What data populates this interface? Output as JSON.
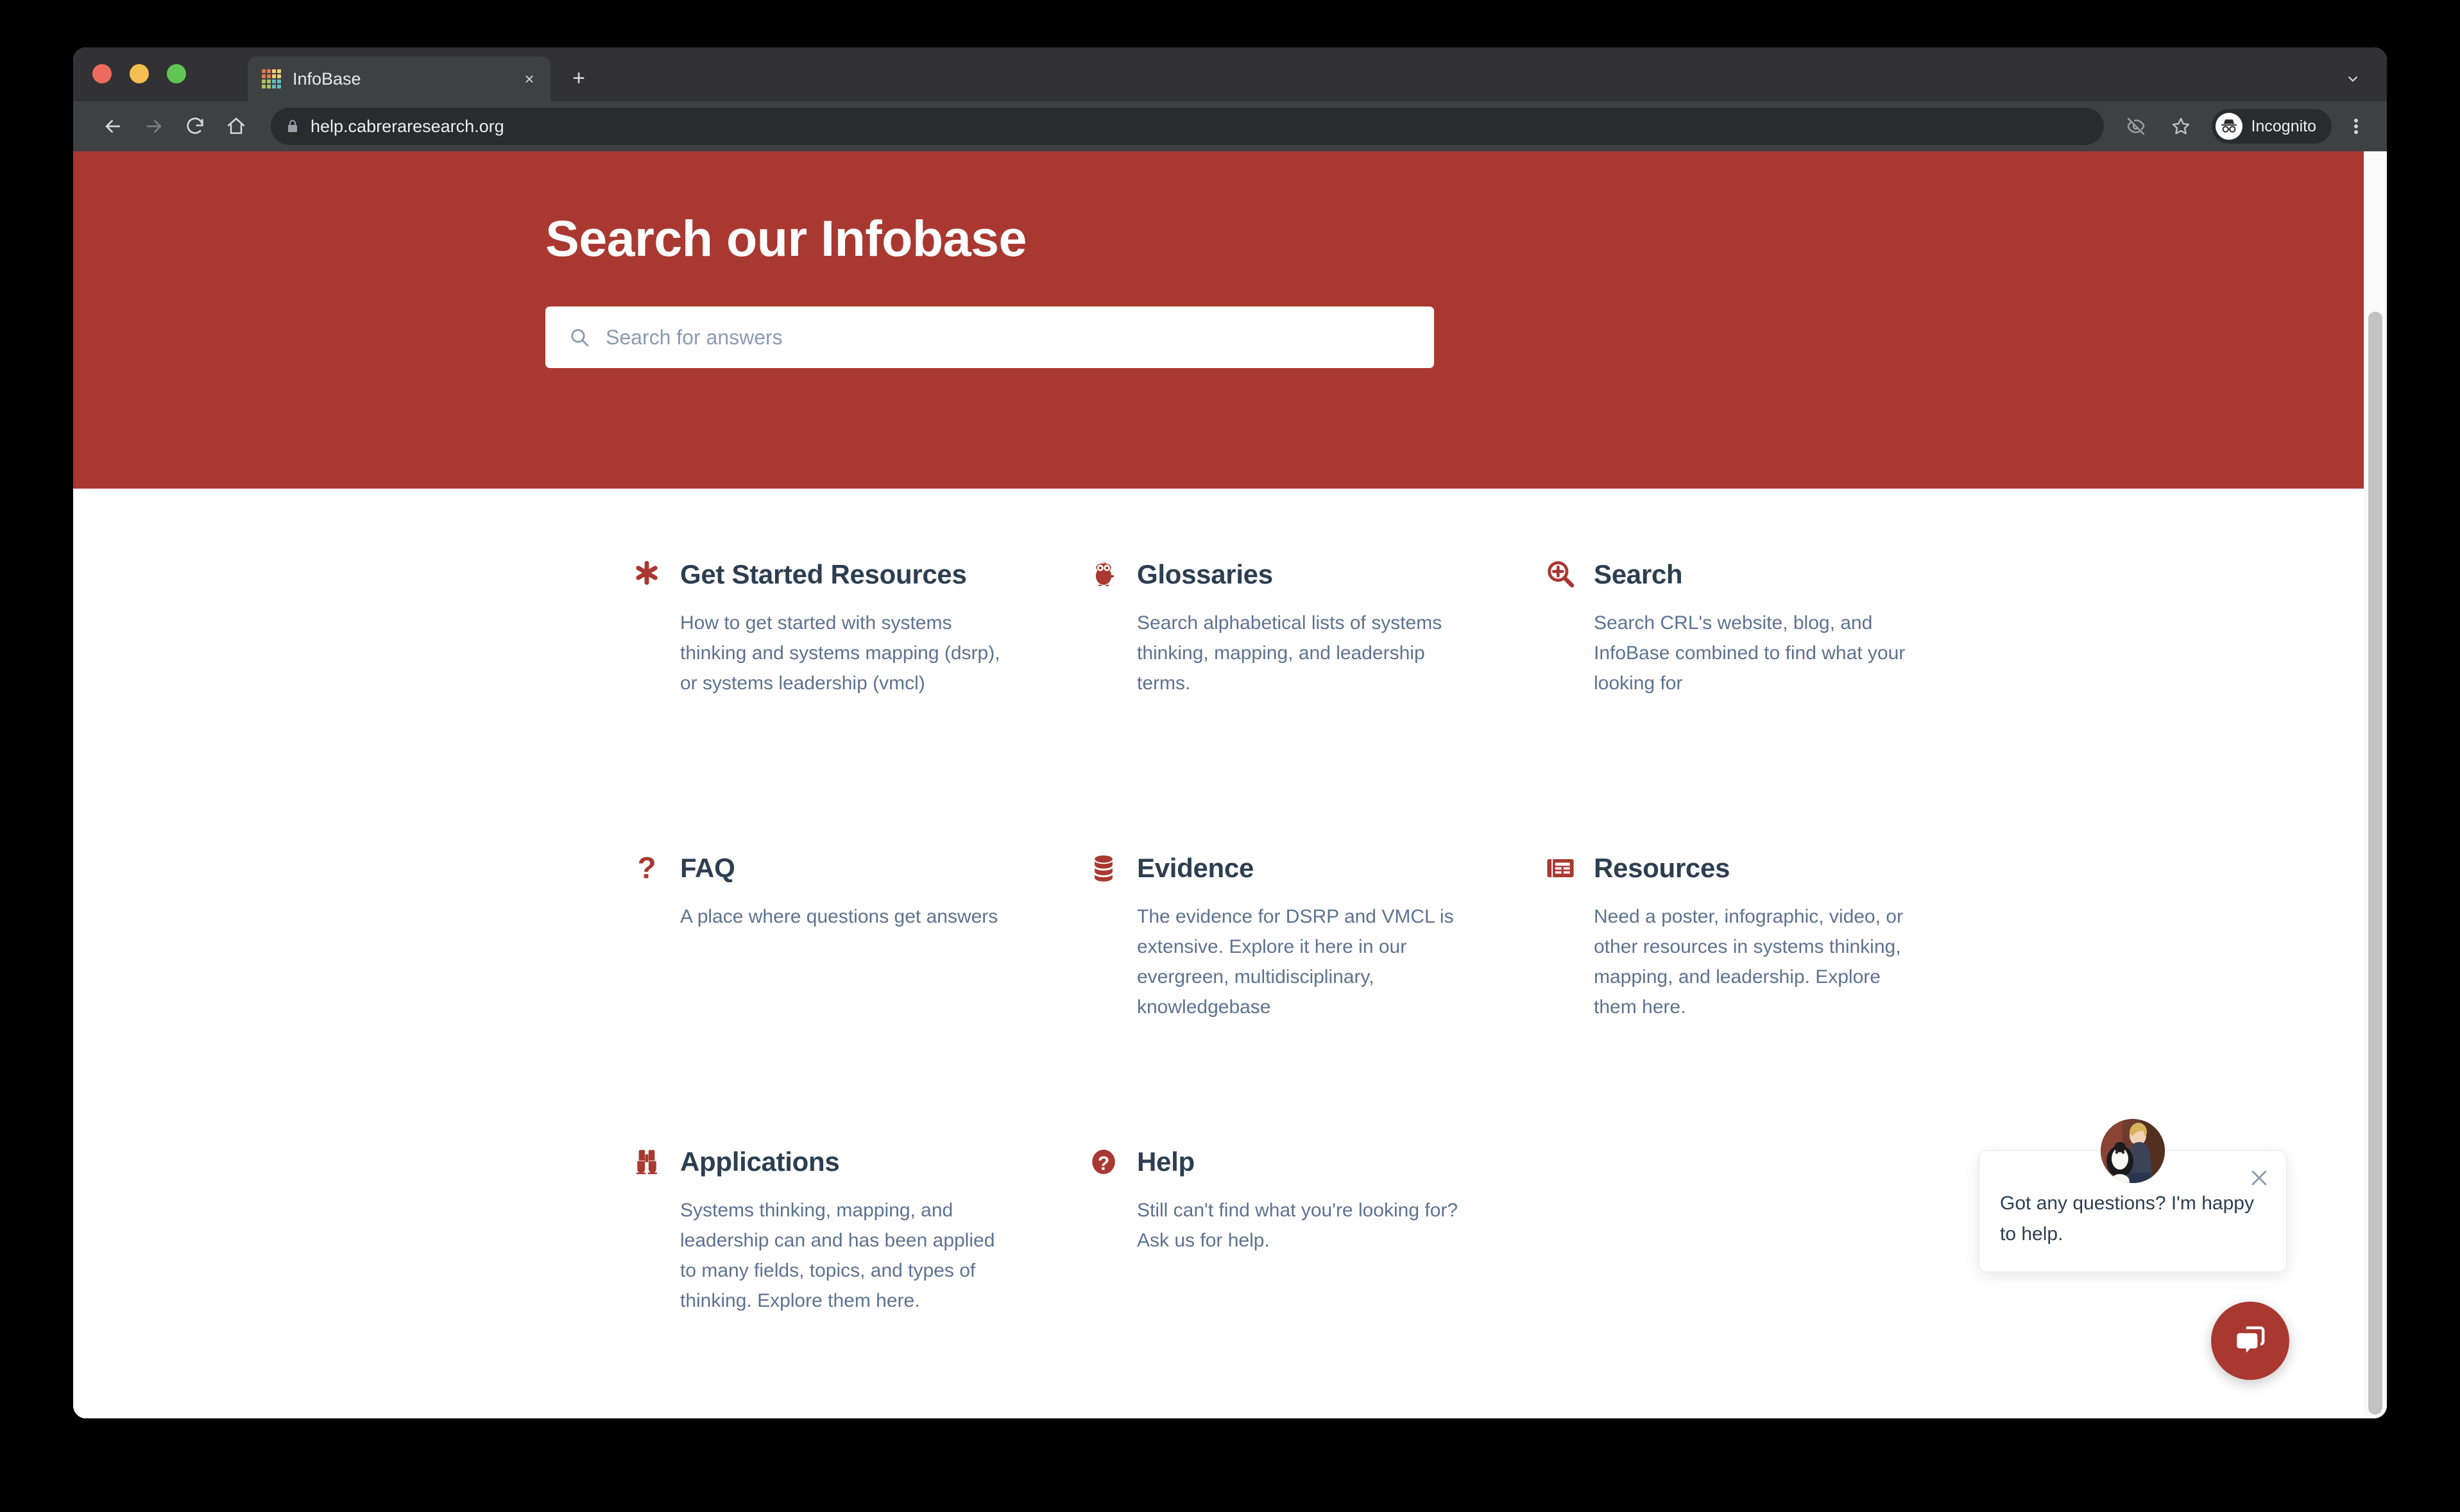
{
  "browser": {
    "tab": {
      "title": "InfoBase",
      "favicon": "infobase-grid-icon",
      "close_label": "×"
    },
    "new_tab_label": "+",
    "tabstrip_caret": "chevron-down-icon",
    "toolbar": {
      "back": "back-arrow-icon",
      "forward": "forward-arrow-icon",
      "reload": "reload-icon",
      "home": "home-icon",
      "lock": "lock-icon",
      "url": "help.cabreraresearch.org",
      "eye_off": "eye-off-icon",
      "bookmark": "star-icon",
      "profile_label": "Incognito",
      "menu": "kebab-menu-icon"
    },
    "favicon_colors": [
      "#E07A4C",
      "#E07A4C",
      "#F2D06B",
      "#F2D06B",
      "#E07A4C",
      "#E07A4C",
      "#F2D06B",
      "#F2D06B",
      "#A8C45A",
      "#A8C45A",
      "#5FBCC4",
      "#5FBCC4",
      "#A8C45A",
      "#A8C45A",
      "#5FBCC4",
      "#5FBCC4"
    ]
  },
  "theme": {
    "brand_red": "#A93831",
    "heading_navy": "#2C3E50",
    "body_blue_grey": "#5D7290",
    "placeholder_grey": "#8C9AB0"
  },
  "hero": {
    "title": "Search our Infobase",
    "search": {
      "placeholder": "Search for answers",
      "value": "",
      "icon": "search-icon"
    }
  },
  "cards": [
    {
      "icon": "asterisk-icon",
      "title": "Get Started Resources",
      "desc": "How to get started with systems thinking and systems mapping (dsrp), or systems leadership (vmcl)"
    },
    {
      "icon": "owl-icon",
      "title": "Glossaries",
      "desc": "Search alphabetical lists of systems thinking, mapping, and leadership terms."
    },
    {
      "icon": "magnifier-plus-icon",
      "title": "Search",
      "desc": "Search CRL's website, blog, and InfoBase combined to find what your looking for"
    },
    {
      "icon": "question-mark-icon",
      "title": "FAQ",
      "desc": "A place where questions get answers"
    },
    {
      "icon": "database-icon",
      "title": "Evidence",
      "desc": "The evidence for DSRP and VMCL is extensive. Explore it here in our evergreen, multidisciplinary, knowledgebase"
    },
    {
      "icon": "list-card-icon",
      "title": "Resources",
      "desc": "Need a poster, infographic, video, or other resources in systems thinking, mapping, and leadership. Explore them here."
    },
    {
      "icon": "binoculars-icon",
      "title": "Applications",
      "desc": "Systems thinking, mapping, and leadership can and has been applied to many fields, topics, and types of thinking. Explore them here."
    },
    {
      "icon": "help-circle-icon",
      "title": "Help",
      "desc": "Still can't find what you're looking for? Ask us for help."
    }
  ],
  "chat": {
    "message": "Got any questions? I'm happy to help.",
    "close_icon": "close-icon",
    "avatar": "agent-avatar",
    "launcher_icon": "chat-bubbles-icon"
  }
}
